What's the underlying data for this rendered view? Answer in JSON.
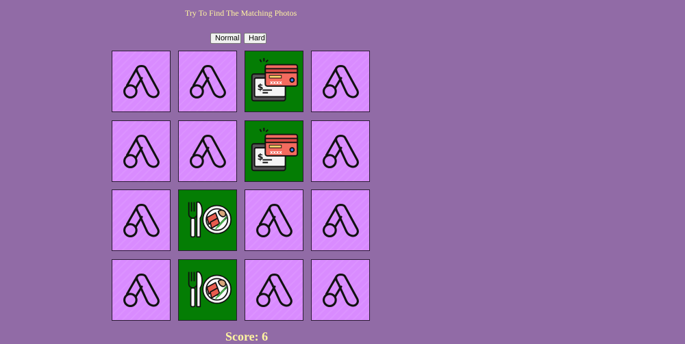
{
  "game": {
    "title": "Try To Find The Matching Photos",
    "difficulty_buttons": {
      "normal": "Normal",
      "hard": "Hard"
    },
    "score_label": "Score:",
    "score_value": 6
  },
  "board": {
    "rows": 4,
    "cols": 4,
    "cards": [
      {
        "state": "hidden",
        "icon": "card-back-logo-icon"
      },
      {
        "state": "hidden",
        "icon": "card-back-logo-icon"
      },
      {
        "state": "revealed",
        "icon": "credit-card-payment-icon"
      },
      {
        "state": "hidden",
        "icon": "card-back-logo-icon"
      },
      {
        "state": "hidden",
        "icon": "card-back-logo-icon"
      },
      {
        "state": "hidden",
        "icon": "card-back-logo-icon"
      },
      {
        "state": "revealed",
        "icon": "credit-card-payment-icon"
      },
      {
        "state": "hidden",
        "icon": "card-back-logo-icon"
      },
      {
        "state": "hidden",
        "icon": "card-back-logo-icon"
      },
      {
        "state": "revealed",
        "icon": "sushi-plate-icon"
      },
      {
        "state": "hidden",
        "icon": "card-back-logo-icon"
      },
      {
        "state": "hidden",
        "icon": "card-back-logo-icon"
      },
      {
        "state": "hidden",
        "icon": "card-back-logo-icon"
      },
      {
        "state": "revealed",
        "icon": "sushi-plate-icon"
      },
      {
        "state": "hidden",
        "icon": "card-back-logo-icon"
      },
      {
        "state": "hidden",
        "icon": "card-back-logo-icon"
      }
    ],
    "colors": {
      "back": "#D98BFF",
      "revealed": "#047D04",
      "page_background": "#916BA6",
      "text": "#FFF4A0"
    }
  }
}
